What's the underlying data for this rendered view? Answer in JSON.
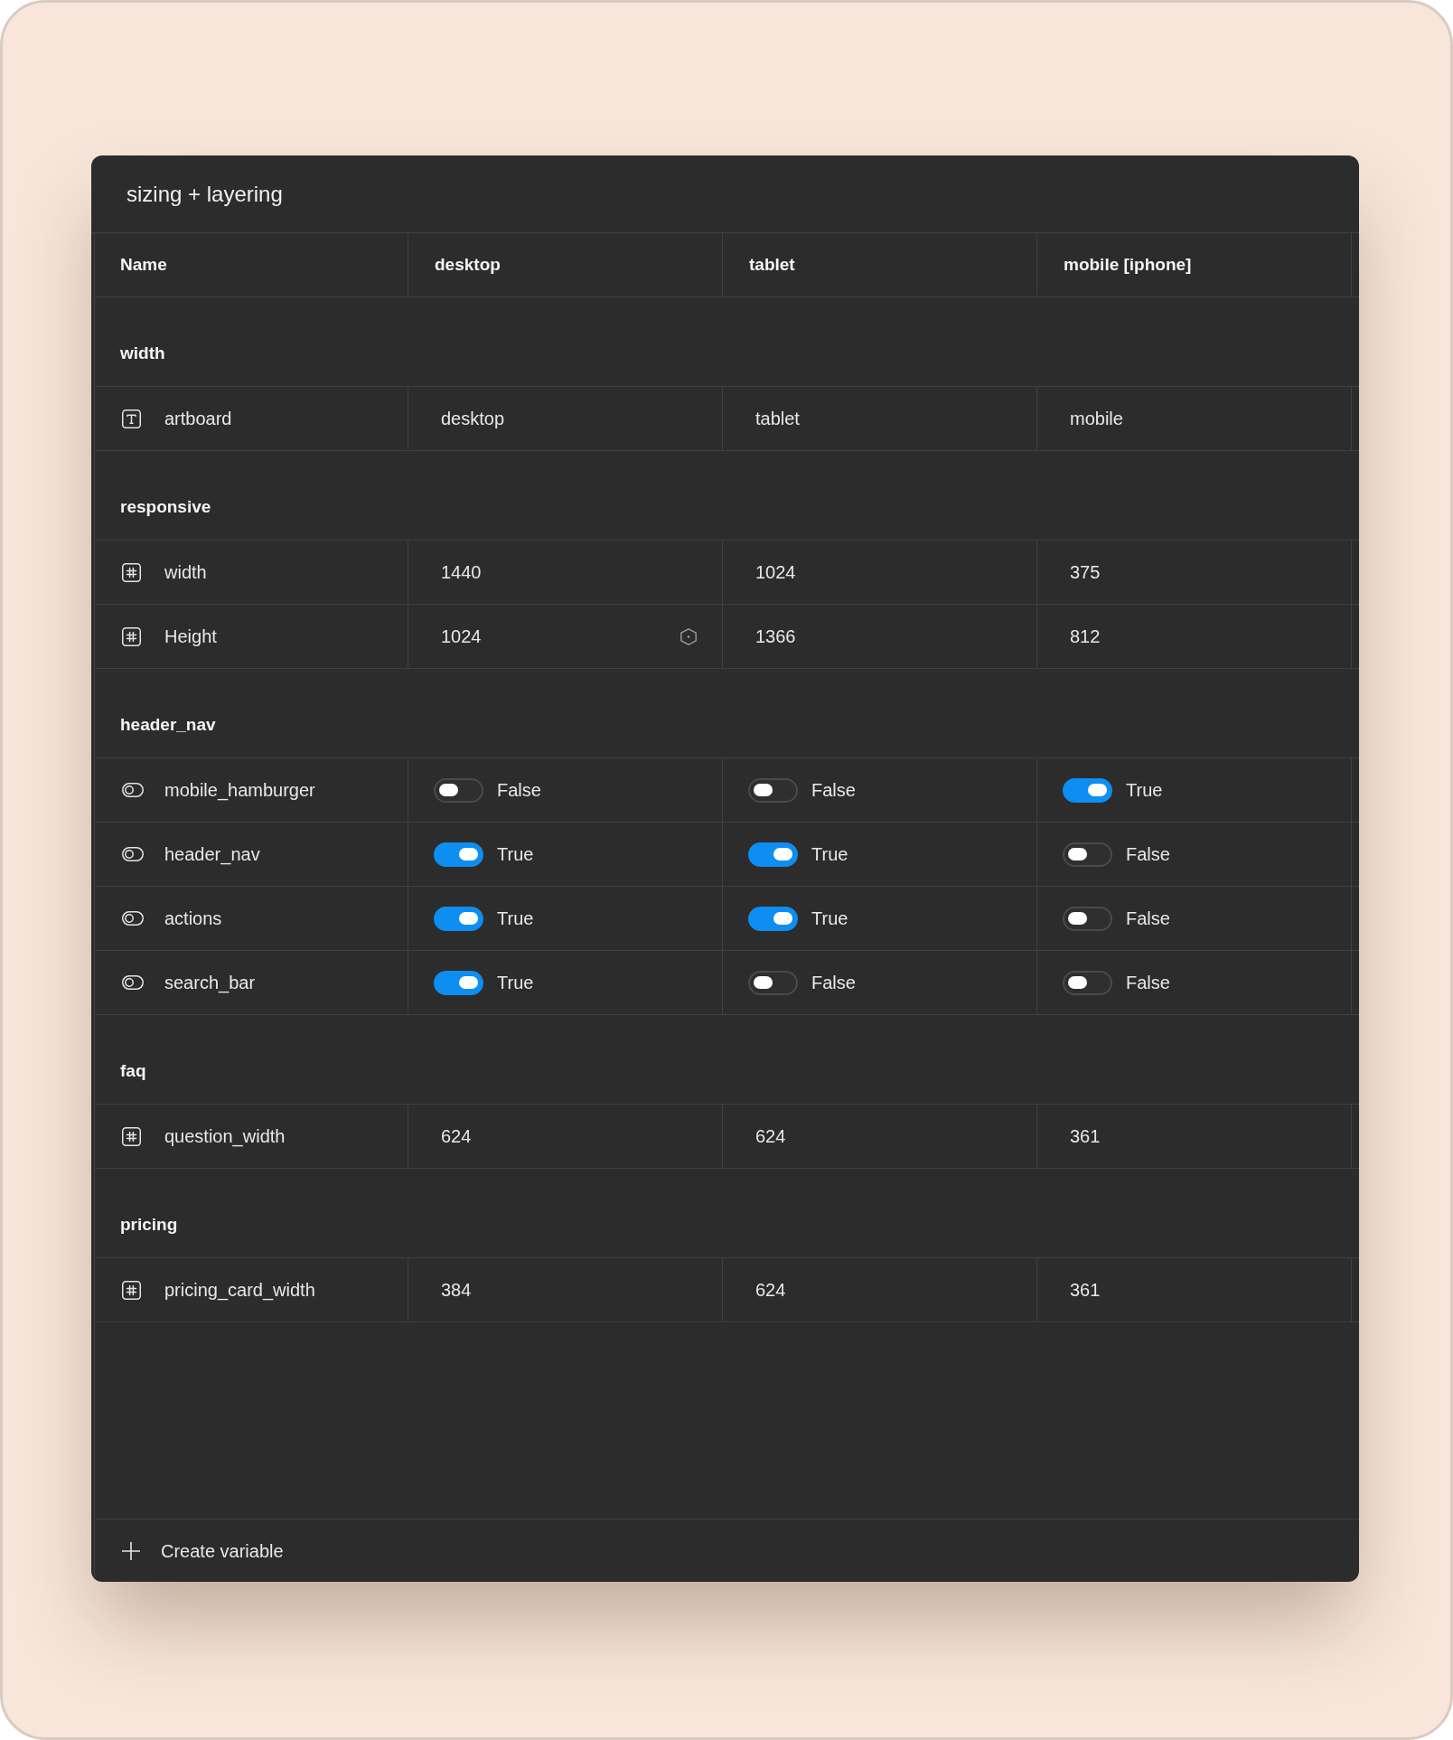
{
  "panel": {
    "title": "sizing + layering"
  },
  "table": {
    "columns": [
      {
        "label": "Name"
      },
      {
        "label": "desktop"
      },
      {
        "label": "tablet"
      },
      {
        "label": "mobile [iphone]"
      }
    ],
    "groups": [
      {
        "label": "width",
        "rows": [
          {
            "kind": "text",
            "name": "artboard",
            "values": [
              {
                "text": "desktop",
                "hovered": false
              },
              {
                "text": "tablet",
                "hovered": false
              },
              {
                "text": "mobile",
                "hovered": false
              }
            ]
          }
        ]
      },
      {
        "label": "responsive",
        "rows": [
          {
            "kind": "number",
            "name": "width",
            "values": [
              {
                "text": "1440",
                "hovered": false
              },
              {
                "text": "1024",
                "hovered": false
              },
              {
                "text": "375",
                "hovered": false
              }
            ]
          },
          {
            "kind": "number",
            "name": "Height",
            "values": [
              {
                "text": "1024",
                "hovered": true
              },
              {
                "text": "1366",
                "hovered": false
              },
              {
                "text": "812",
                "hovered": false
              }
            ]
          }
        ]
      },
      {
        "label": "header_nav",
        "rows": [
          {
            "kind": "boolean",
            "name": "mobile_hamburger",
            "values": [
              {
                "on": false,
                "text": "False",
                "hovered": false
              },
              {
                "on": false,
                "text": "False",
                "hovered": false
              },
              {
                "on": true,
                "text": "True",
                "hovered": false
              }
            ]
          },
          {
            "kind": "boolean",
            "name": "header_nav",
            "values": [
              {
                "on": true,
                "text": "True",
                "hovered": false
              },
              {
                "on": true,
                "text": "True",
                "hovered": false
              },
              {
                "on": false,
                "text": "False",
                "hovered": false
              }
            ]
          },
          {
            "kind": "boolean",
            "name": "actions",
            "values": [
              {
                "on": true,
                "text": "True",
                "hovered": false
              },
              {
                "on": true,
                "text": "True",
                "hovered": false
              },
              {
                "on": false,
                "text": "False",
                "hovered": false
              }
            ]
          },
          {
            "kind": "boolean",
            "name": "search_bar",
            "values": [
              {
                "on": true,
                "text": "True",
                "hovered": false
              },
              {
                "on": false,
                "text": "False",
                "hovered": false
              },
              {
                "on": false,
                "text": "False",
                "hovered": false
              }
            ]
          }
        ]
      },
      {
        "label": "faq",
        "rows": [
          {
            "kind": "number",
            "name": "question_width",
            "values": [
              {
                "text": "624",
                "hovered": false
              },
              {
                "text": "624",
                "hovered": false
              },
              {
                "text": "361",
                "hovered": false
              }
            ]
          }
        ]
      },
      {
        "label": "pricing",
        "rows": [
          {
            "kind": "number",
            "name": "pricing_card_width",
            "values": [
              {
                "text": "384",
                "hovered": false
              },
              {
                "text": "624",
                "hovered": false
              },
              {
                "text": "361",
                "hovered": false
              }
            ]
          }
        ]
      }
    ]
  },
  "footer": {
    "button": "Create variable"
  }
}
